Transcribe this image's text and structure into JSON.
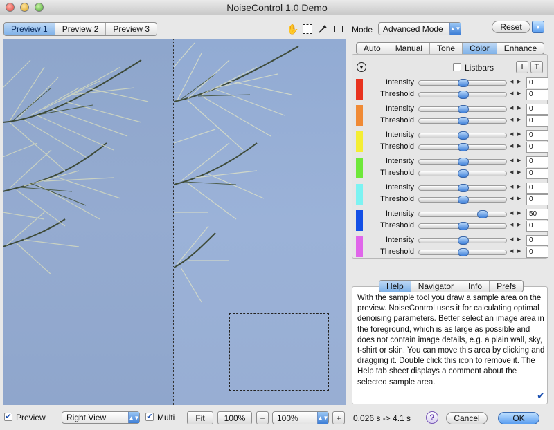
{
  "window": {
    "title": "NoiseControl 1.0 Demo"
  },
  "preview_tabs": [
    "Preview 1",
    "Preview 2",
    "Preview 3"
  ],
  "mode": {
    "label": "Mode",
    "value": "Advanced Mode"
  },
  "reset_label": "Reset",
  "main_tabs": [
    "Auto",
    "Manual",
    "Tone",
    "Color",
    "Enhance"
  ],
  "listbars_label": "Listbars",
  "side_buttons": [
    "I",
    "T"
  ],
  "colors": [
    "#e8331f",
    "#f08a35",
    "#f4ee34",
    "#6ee83a",
    "#7cf3f2",
    "#1450e6",
    "#e066ea"
  ],
  "channels": [
    {
      "intensity": "0",
      "threshold": "0"
    },
    {
      "intensity": "0",
      "threshold": "0"
    },
    {
      "intensity": "0",
      "threshold": "0"
    },
    {
      "intensity": "0",
      "threshold": "0"
    },
    {
      "intensity": "0",
      "threshold": "0"
    },
    {
      "intensity": "50",
      "threshold": "0"
    },
    {
      "intensity": "0",
      "threshold": "0"
    }
  ],
  "labels": {
    "intensity": "Intensity",
    "threshold": "Threshold"
  },
  "help_tabs": [
    "Help",
    "Navigator",
    "Info",
    "Prefs"
  ],
  "help_text": "With the sample tool you draw a sample area on the preview. NoiseControl uses it for calculating optimal denoising parameters. Better select an image area in the foreground, which is as large as possible and does not contain image details, e.g. a plain wall, sky, t-shirt or skin. You can move this area by clicking and dragging it. Double click this icon to remove it. The Help tab sheet displays a comment about the selected sample area.",
  "bottom": {
    "preview_label": "Preview",
    "view_select": "Right View",
    "multi_label": "Multi",
    "fit_label": "Fit",
    "zoom_value": "100%",
    "zoom_select": "100%",
    "timing": "0.026 s -> 4.1 s",
    "cancel_label": "Cancel",
    "ok_label": "OK"
  }
}
